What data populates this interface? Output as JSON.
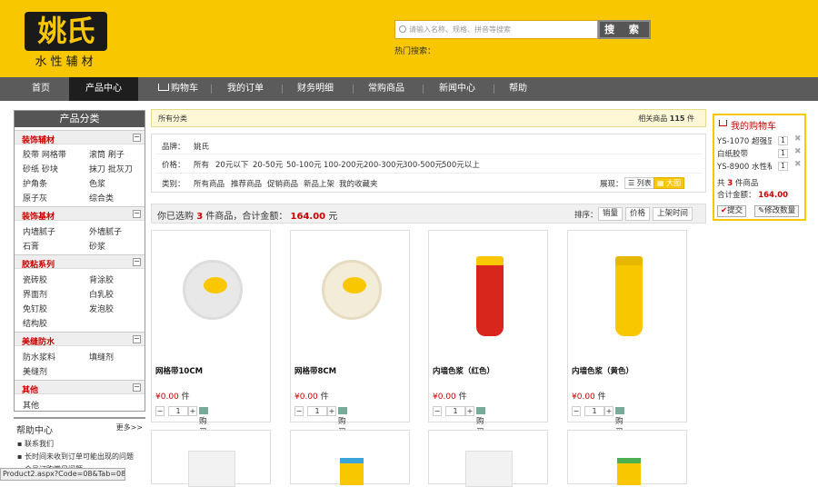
{
  "brand": {
    "logo_text": "姚氏",
    "tagline": "水性辅材"
  },
  "search": {
    "placeholder": "请输入名称、规格、拼音等搜索",
    "button": "搜 索",
    "hot_label": "热门搜索："
  },
  "nav": [
    "首页",
    "产品中心",
    "购物车",
    "我的订单",
    "财务明细",
    "常购商品",
    "新闻中心",
    "帮助"
  ],
  "sidebar": {
    "title": "产品分类",
    "groups": [
      {
        "name": "装饰辅材",
        "items": [
          "胶带 网格带",
          "滚筒 刷子",
          "砂纸 砂块",
          "抹刀 批灰刀",
          "护角条",
          "色浆",
          "原子灰",
          "综合类"
        ]
      },
      {
        "name": "装饰基材",
        "items": [
          "内墙腻子",
          "外墙腻子",
          "石膏",
          "砂浆"
        ]
      },
      {
        "name": "胶粘系列",
        "items": [
          "瓷砖胶",
          "背涂胶",
          "界面剂",
          "白乳胶",
          "免钉胶",
          "发泡胶",
          "结构胶"
        ]
      },
      {
        "name": "美缝防水",
        "items": [
          "防水浆料",
          "填缝剂",
          "美缝剂"
        ]
      },
      {
        "name": "其他",
        "items": [
          "其他"
        ]
      }
    ]
  },
  "help": {
    "title": "帮助中心",
    "more": "更多>>",
    "items": [
      "联系我们",
      "长时间未收到订单可能出现的问题",
      "会员订购常见问题"
    ]
  },
  "status_bar": "Product2.aspx?Code=08&Tab=08",
  "crumb": {
    "all": "所有分类",
    "related_prefix": "相关商品",
    "count": "115",
    "unit": "件"
  },
  "filter": {
    "brand_label": "品牌：",
    "brand_value": "姚氏",
    "price_label": "价格：",
    "prices": [
      "所有",
      "20元以下",
      "20-50元",
      "50-100元",
      "100-200元",
      "200-300元",
      "300-500元",
      "500元以上"
    ],
    "type_label": "类别：",
    "types": [
      "所有商品",
      "推荐商品",
      "促销商品",
      "新品上架",
      "我的收藏夹"
    ],
    "view_label": "展现：",
    "view_list": "列表",
    "view_grid": "大图"
  },
  "selected": {
    "prefix": "你已选购",
    "count": "3",
    "mid": "件商品，合计金额：",
    "amount": "164.00",
    "unit": "元"
  },
  "sort": {
    "label": "排序：",
    "options": [
      "销量",
      "价格",
      "上架时间"
    ]
  },
  "products": [
    {
      "name": "网格带10CM",
      "price": "0.00",
      "unit": "件",
      "qty": "1",
      "buy": "购买"
    },
    {
      "name": "网格带8CM",
      "price": "0.00",
      "unit": "件",
      "qty": "1",
      "buy": "购买"
    },
    {
      "name": "内墙色浆（红色）",
      "price": "0.00",
      "unit": "件",
      "qty": "1",
      "buy": "购买"
    },
    {
      "name": "内墙色浆（黄色）",
      "price": "0.00",
      "unit": "件",
      "qty": "1",
      "buy": "购买"
    }
  ],
  "currency": "¥",
  "cart": {
    "title": "我的购物车",
    "items": [
      {
        "name": "YS-1070 超强显",
        "qty": "1"
      },
      {
        "name": "白纸胶带",
        "qty": "1"
      },
      {
        "name": "YS-8900 水性私",
        "qty": "1"
      }
    ],
    "count_prefix": "共",
    "count": "3",
    "count_suffix": "件商品",
    "total_label": "合计金额：",
    "total": "164.00",
    "submit": "提交",
    "modify": "修改数量"
  },
  "colors": {
    "brand_yellow": "#f9c700",
    "nav_bg": "#5b5b5b",
    "accent_red": "#cc0000"
  }
}
